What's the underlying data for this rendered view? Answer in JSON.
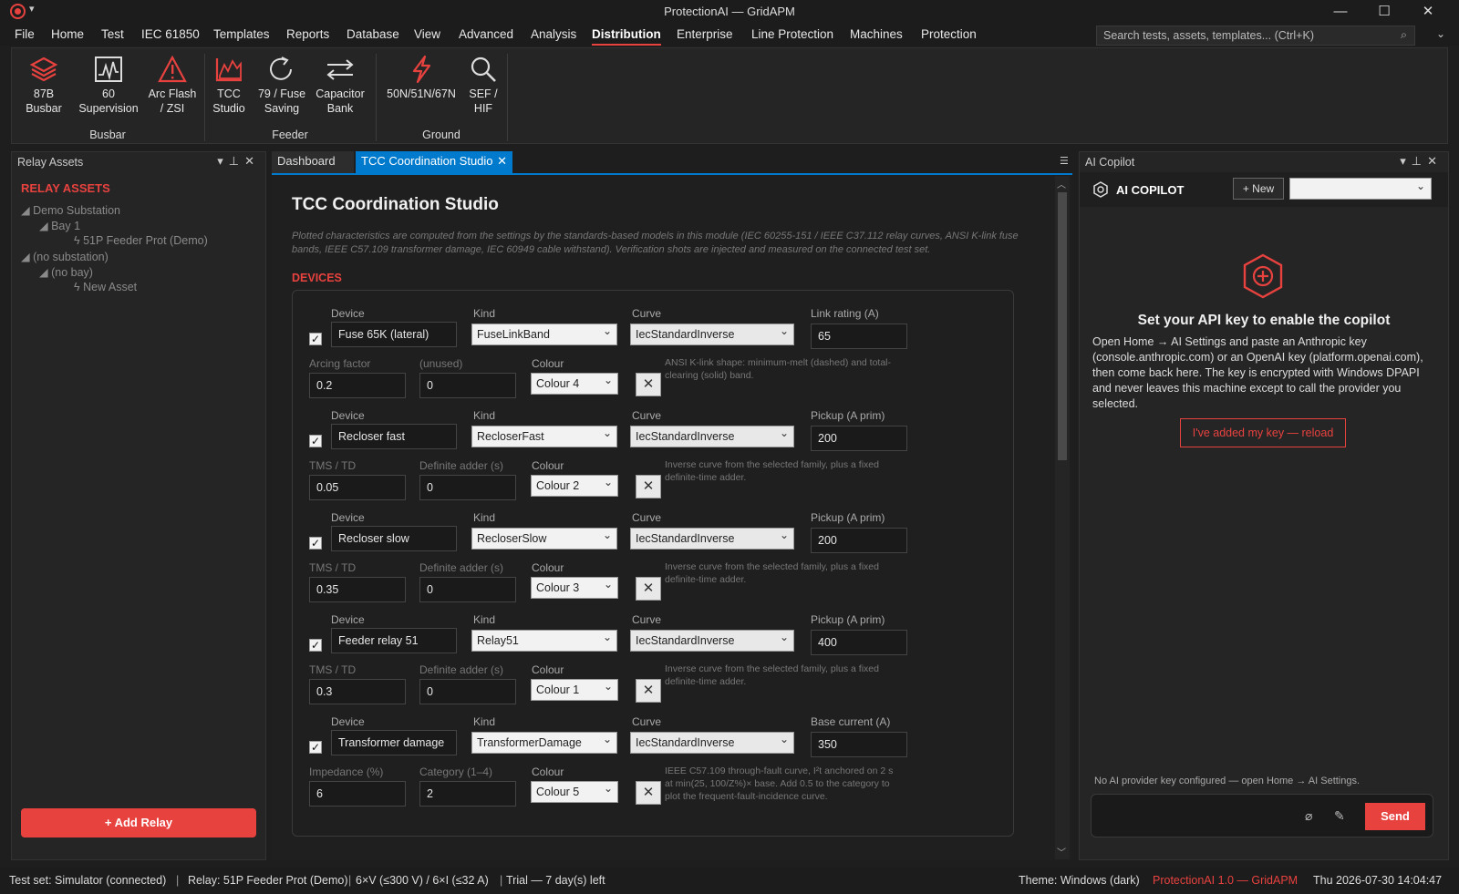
{
  "window": {
    "title": "ProtectionAI — GridAPM",
    "quick_access": "▾",
    "minimize": "—",
    "maximize": "☐",
    "close": "✕"
  },
  "menu": [
    {
      "label": "File"
    },
    {
      "label": "Home"
    },
    {
      "label": "Test"
    },
    {
      "label": "IEC 61850"
    },
    {
      "label": "Templates"
    },
    {
      "label": "Reports"
    },
    {
      "label": "Database"
    },
    {
      "label": "View"
    },
    {
      "label": "Advanced"
    },
    {
      "label": "Analysis"
    },
    {
      "label": "Distribution",
      "active": true
    },
    {
      "label": "Enterprise"
    },
    {
      "label": "Line Protection"
    },
    {
      "label": "Machines"
    },
    {
      "label": "Protection"
    }
  ],
  "search": {
    "placeholder": "Search tests, assets, templates... (Ctrl+K)"
  },
  "ribbon": {
    "buttons": [
      {
        "line1": "87B",
        "line2": "Busbar",
        "icon": "layers-icon"
      },
      {
        "line1": "60",
        "line2": "Supervision",
        "icon": "waveform-icon"
      },
      {
        "line1": "Arc Flash",
        "line2": "/ ZSI",
        "icon": "warning-icon"
      },
      {
        "line1": "TCC",
        "line2": "Studio",
        "icon": "chart-icon"
      },
      {
        "line1": "79 / Fuse",
        "line2": "Saving",
        "icon": "refresh-icon"
      },
      {
        "line1": "Capacitor",
        "line2": "Bank",
        "icon": "swap-icon"
      },
      {
        "line1": "50N/51N/67N",
        "line2": "",
        "icon": "lightning-icon"
      },
      {
        "line1": "SEF /",
        "line2": "HIF",
        "icon": "search-icon"
      }
    ],
    "groups": [
      "Busbar",
      "Feeder",
      "Ground"
    ]
  },
  "relay_assets": {
    "panel_title": "Relay Assets",
    "heading": "RELAY ASSETS",
    "tree": [
      {
        "label": "Demo Substation",
        "level": 0
      },
      {
        "label": "Bay 1",
        "level": 1
      },
      {
        "label": "51P Feeder Prot (Demo)",
        "level": 2
      },
      {
        "label": "(no substation)",
        "level": 0
      },
      {
        "label": "(no bay)",
        "level": 1
      },
      {
        "label": "New Asset",
        "level": 2
      }
    ],
    "add_button": "+ Add Relay"
  },
  "tabs": [
    {
      "label": "Dashboard"
    },
    {
      "label": "TCC Coordination Studio"
    }
  ],
  "tcc": {
    "title": "TCC Coordination Studio",
    "description": "Plotted characteristics are computed from the settings by the standards-based models in this module (IEC 60255-151 / IEEE C37.112 relay curves, ANSI K-link fuse bands, IEEE C57.109 transformer damage, IEC 60949 cable withstand). Verification shots are injected and measured on the connected test set.",
    "section": "DEVICES",
    "labels": {
      "device": "Device",
      "kind": "Kind",
      "curve": "Curve",
      "colour": "Colour"
    },
    "devices": [
      {
        "checked": true,
        "name": "Fuse 65K (lateral)",
        "kind": "FuseLinkBand",
        "curve": "IecStandardInverse",
        "rating_label": "Link rating (A)",
        "rating": "65",
        "p1_label": "Arcing factor",
        "p1": "0.2",
        "p2_label": "(unused)",
        "p2": "0",
        "colour": "Colour 4",
        "note": "ANSI K-link shape: minimum-melt (dashed) and total-clearing (solid) band."
      },
      {
        "checked": true,
        "name": "Recloser fast",
        "kind": "RecloserFast",
        "curve": "IecStandardInverse",
        "rating_label": "Pickup (A prim)",
        "rating": "200",
        "p1_label": "TMS / TD",
        "p1": "0.05",
        "p2_label": "Definite adder (s)",
        "p2": "0",
        "colour": "Colour 2",
        "note": "Inverse curve from the selected family, plus a fixed definite-time adder."
      },
      {
        "checked": true,
        "name": "Recloser slow",
        "kind": "RecloserSlow",
        "curve": "IecStandardInverse",
        "rating_label": "Pickup (A prim)",
        "rating": "200",
        "p1_label": "TMS / TD",
        "p1": "0.35",
        "p2_label": "Definite adder (s)",
        "p2": "0",
        "colour": "Colour 3",
        "note": "Inverse curve from the selected family, plus a fixed definite-time adder."
      },
      {
        "checked": true,
        "name": "Feeder relay 51",
        "kind": "Relay51",
        "curve": "IecStandardInverse",
        "rating_label": "Pickup (A prim)",
        "rating": "400",
        "p1_label": "TMS / TD",
        "p1": "0.3",
        "p2_label": "Definite adder (s)",
        "p2": "0",
        "colour": "Colour 1",
        "note": "Inverse curve from the selected family, plus a fixed definite-time adder."
      },
      {
        "checked": true,
        "name": "Transformer damage",
        "kind": "TransformerDamage",
        "curve": "IecStandardInverse",
        "rating_label": "Base current (A)",
        "rating": "350",
        "p1_label": "Impedance (%)",
        "p1": "6",
        "p2_label": "Category (1–4)",
        "p2": "2",
        "colour": "Colour 5",
        "note": "IEEE C57.109 through-fault curve, I²t anchored on 2 s at min(25, 100/Z%)× base. Add 0.5 to the category to plot the frequent-fault-incidence curve."
      }
    ]
  },
  "copilot": {
    "panel_title": "AI Copilot",
    "title": "AI COPILOT",
    "new_button": "+ New",
    "heading": "Set your API key to enable the copilot",
    "body": "Open Home → AI Settings and paste an Anthropic key (console.anthropic.com) or an OpenAI key (platform.openai.com), then come back here. The key is encrypted with Windows DPAPI and never leaves this machine except to call the provider you selected.",
    "reload_button": "I've added my key — reload",
    "status": "No AI provider key configured — open Home → AI Settings.",
    "send": "Send"
  },
  "statusbar": {
    "test_set": "Test set: Simulator (connected)",
    "relay": "Relay: 51P Feeder Prot (Demo)",
    "limits": "6×V (≤300 V) / 6×I (≤32 A)",
    "trial": "Trial — 7 day(s) left",
    "theme": "Theme: Windows (dark)",
    "version": "ProtectionAI 1.0 — GridAPM",
    "clock": "Thu 2026-07-30 14:04:47"
  },
  "colors": {
    "accent": "#e8423f",
    "tab_active": "#007acc",
    "background": "#1e1e1e"
  }
}
